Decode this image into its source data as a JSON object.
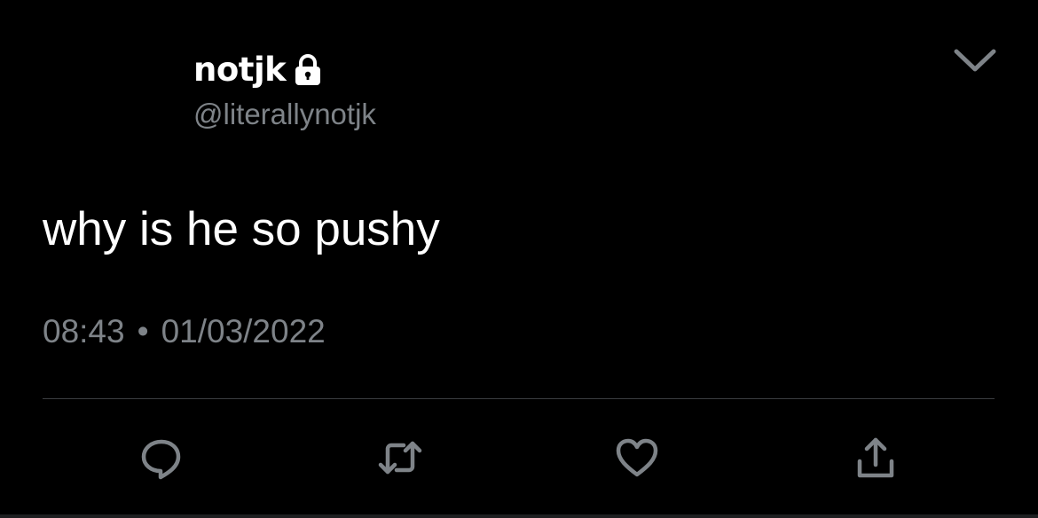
{
  "tweet": {
    "display_name": "notjk",
    "handle": "@literallynotjk",
    "text": "why is he so pushy",
    "time": "08:43",
    "separator": "•",
    "date": "01/03/2022",
    "protected": true
  },
  "icons": {
    "lock": "lock-icon",
    "more": "chevron-down-icon",
    "reply": "reply-icon",
    "retweet": "retweet-icon",
    "like": "heart-icon",
    "share": "share-icon"
  },
  "colors": {
    "background": "#000000",
    "text": "#ffffff",
    "secondary_text": "#7e8388",
    "divider": "#3a3d40"
  }
}
